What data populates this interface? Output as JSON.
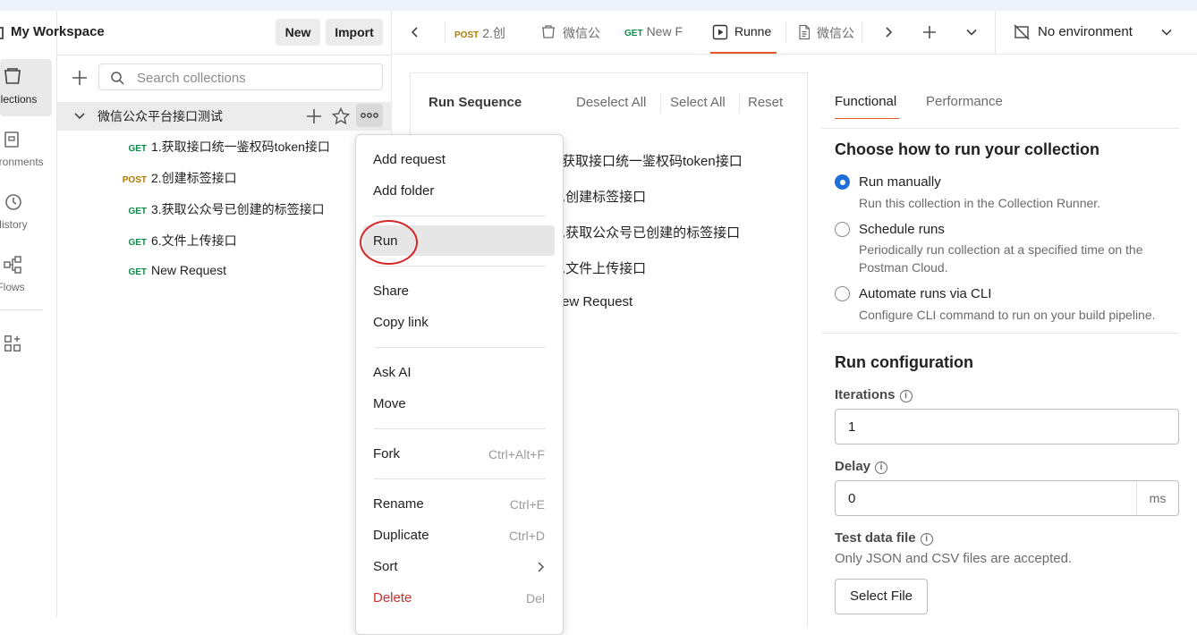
{
  "workspace": {
    "title": "My Workspace",
    "new_label": "New",
    "import_label": "Import"
  },
  "rail": {
    "items": [
      {
        "label": "Collections",
        "icon": "collections-icon",
        "active": true
      },
      {
        "label": "Environments",
        "icon": "environments-icon"
      },
      {
        "label": "History",
        "icon": "history-icon"
      },
      {
        "label": "Flows",
        "icon": "flows-icon"
      }
    ],
    "extra_icon": "apps-icon"
  },
  "sidebar": {
    "search_placeholder": "Search collections",
    "collection": {
      "name": "微信公众平台接口测试",
      "expanded": true
    },
    "requests": [
      {
        "method": "GET",
        "name": "1.获取接口统一鉴权码token接口"
      },
      {
        "method": "POST",
        "name": "2.创建标签接口"
      },
      {
        "method": "GET",
        "name": "3.获取公众号已创建的标签接口"
      },
      {
        "method": "GET",
        "name": "6.文件上传接口"
      },
      {
        "method": "GET",
        "name": "New Request"
      }
    ]
  },
  "tabs": {
    "items": [
      {
        "method": "POST",
        "label": "2.创",
        "icon": ""
      },
      {
        "method": "",
        "label": "微信公",
        "icon": "collection-icon"
      },
      {
        "method": "GET",
        "label": "New F",
        "icon": ""
      },
      {
        "method": "",
        "label": "Runne",
        "icon": "runner-icon",
        "active": true
      },
      {
        "method": "",
        "label": "微信公",
        "icon": "document-icon"
      }
    ],
    "environment": "No environment"
  },
  "run_sequence": {
    "title": "Run Sequence",
    "deselect_all": "Deselect All",
    "select_all": "Select All",
    "reset": "Reset",
    "items": [
      "获取接口统一鉴权码token接口",
      ".创建标签接口",
      ".获取公众号已创建的标签接口",
      ".文件上传接口",
      "ew Request"
    ]
  },
  "runner": {
    "tabs": [
      "Functional",
      "Performance"
    ],
    "choose_heading": "Choose how to run your collection",
    "options": [
      {
        "title": "Run manually",
        "desc": "Run this collection in the Collection Runner.",
        "selected": true
      },
      {
        "title": "Schedule runs",
        "desc": "Periodically run collection at a specified time on the Postman Cloud.",
        "selected": false
      },
      {
        "title": "Automate runs via CLI",
        "desc": "Configure CLI command to run on your build pipeline.",
        "selected": false
      }
    ],
    "config_heading": "Run configuration",
    "iterations_label": "Iterations",
    "iterations_value": "1",
    "delay_label": "Delay",
    "delay_value": "0",
    "delay_unit": "ms",
    "test_data_label": "Test data file",
    "test_data_hint": "Only JSON and CSV files are accepted.",
    "select_file": "Select File"
  },
  "context_menu": {
    "add_request": "Add request",
    "add_folder": "Add folder",
    "run": "Run",
    "share": "Share",
    "copy_link": "Copy link",
    "ask_ai": "Ask AI",
    "move": "Move",
    "fork": "Fork",
    "fork_shortcut": "Ctrl+Alt+F",
    "rename": "Rename",
    "rename_shortcut": "Ctrl+E",
    "duplicate": "Duplicate",
    "duplicate_shortcut": "Ctrl+D",
    "sort": "Sort",
    "delete": "Delete",
    "delete_shortcut": "Del"
  },
  "colors": {
    "accent": "#e5572c",
    "get": "#0f8a4a",
    "post": "#ad7a03",
    "radio_on": "#1f6fd6",
    "delete": "#c9302c",
    "highlight_ring": "#d62828"
  }
}
